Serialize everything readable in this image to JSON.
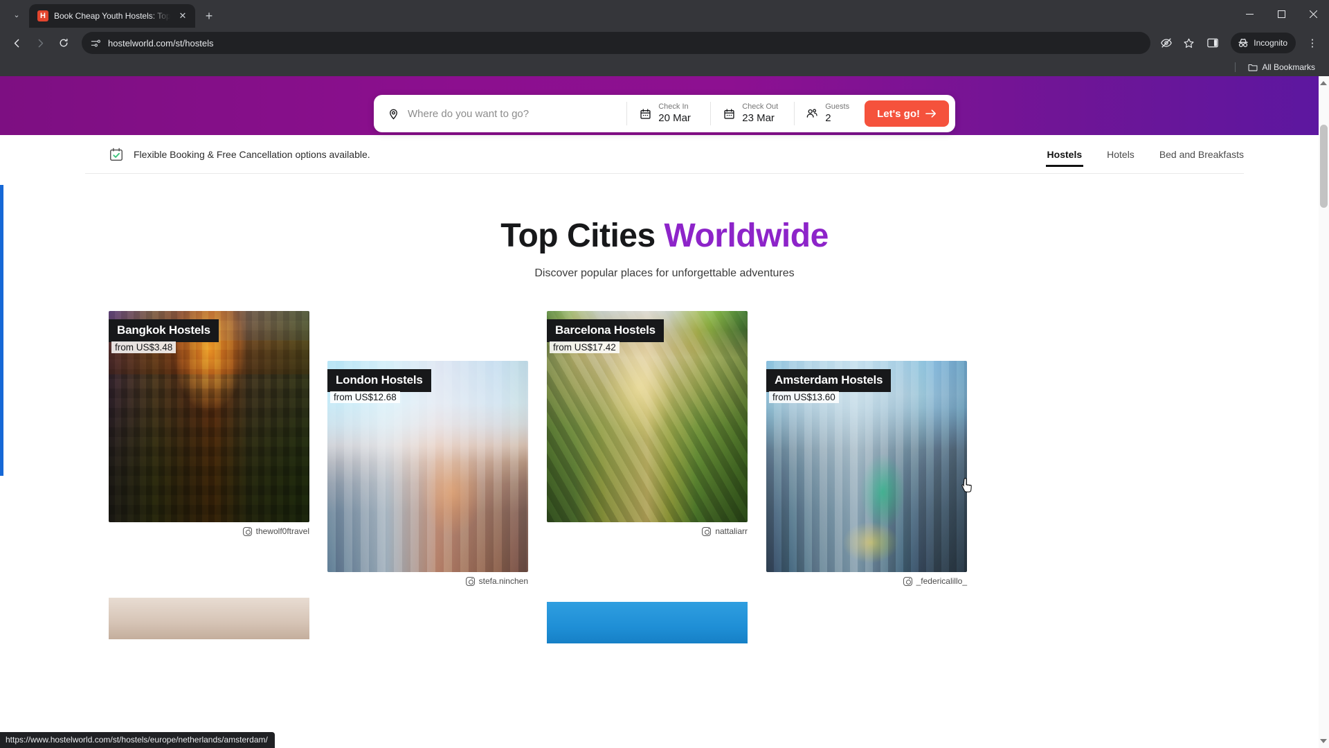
{
  "browser": {
    "tab": {
      "title": "Book Cheap Youth Hostels: Top",
      "favicon_letter": "H",
      "close_label": "✕"
    },
    "new_tab_label": "+",
    "tab_list_label": "⌄",
    "window": {
      "minimize": "—",
      "maximize": "☐",
      "close": "✕"
    },
    "toolbar": {
      "back_label": "←",
      "forward_label": "→",
      "reload_label": "↻",
      "url": "hostelworld.com/st/hostels",
      "incognito_label": "Incognito",
      "menu_label": "⋮"
    },
    "bookmarks": {
      "all_bookmarks_label": "All Bookmarks"
    },
    "status_url": "https://www.hostelworld.com/st/hostels/europe/netherlands/amsterdam/"
  },
  "search": {
    "destination_placeholder": "Where do you want to go?",
    "checkin": {
      "label": "Check In",
      "value": "20 Mar"
    },
    "checkout": {
      "label": "Check Out",
      "value": "23 Mar"
    },
    "guests": {
      "label": "Guests",
      "value": "2"
    },
    "submit_label": "Let's go!",
    "submit_arrow": "→"
  },
  "notice": {
    "text": "Flexible Booking & Free Cancellation options available."
  },
  "nav_tabs": [
    {
      "label": "Hostels",
      "active": true
    },
    {
      "label": "Hotels",
      "active": false
    },
    {
      "label": "Bed and Breakfasts",
      "active": false
    }
  ],
  "main": {
    "title_plain": "Top Cities ",
    "title_accent": "Worldwide",
    "subtitle": "Discover popular places for unforgettable adventures"
  },
  "cities": [
    {
      "name": "Bangkok Hostels",
      "price": "from US$3.48",
      "credit": "thewolf0ftravel"
    },
    {
      "name": "London Hostels",
      "price": "from US$12.68",
      "credit": "stefa.ninchen"
    },
    {
      "name": "Barcelona Hostels",
      "price": "from US$17.42",
      "credit": "nattaliarr"
    },
    {
      "name": "Amsterdam Hostels",
      "price": "from US$13.60",
      "credit": "_federicalillo_"
    }
  ],
  "colors": {
    "hero_purple": "#8c0f8f",
    "accent_purple": "#8d24c9",
    "cta_orange": "#f5523c",
    "chip_black": "#17181a",
    "left_strip_blue": "#1668d6"
  }
}
